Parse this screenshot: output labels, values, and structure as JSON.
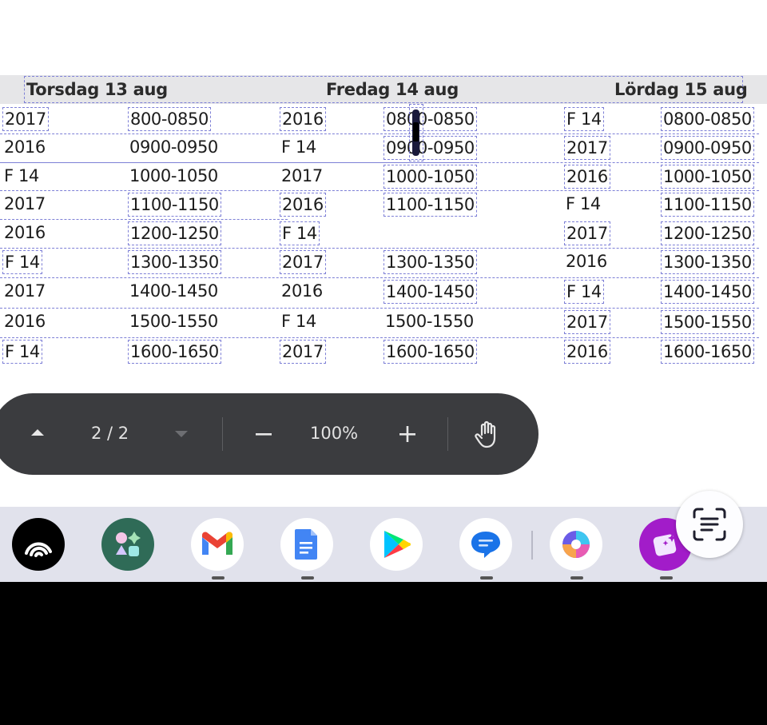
{
  "days": [
    {
      "label": "Torsdag 13 aug"
    },
    {
      "label": "Fredag 14 aug"
    },
    {
      "label": "Lördag 15 aug"
    }
  ],
  "rows": [
    [
      "2017",
      "800-0850",
      "2016",
      "0800-0850",
      "F 14",
      "0800-0850"
    ],
    [
      "2016",
      "0900-0950",
      "F 14",
      "0900-0950",
      "2017",
      "0900-0950"
    ],
    [
      "F 14",
      "1000-1050",
      "2017",
      "1000-1050",
      "2016",
      "1000-1050"
    ],
    [
      "2017",
      "1100-1150",
      "2016",
      "1100-1150",
      "F 14",
      "1100-1150"
    ],
    [
      "2016",
      "1200-1250",
      "F 14",
      "",
      "2017",
      "1200-1250"
    ],
    [
      "F 14",
      "1300-1350",
      "2017",
      "1300-1350",
      "2016",
      "1300-1350"
    ],
    [
      "2017",
      "1400-1450",
      "2016",
      "1400-1450",
      "F 14",
      "1400-1450"
    ],
    [
      "2016",
      "1500-1550",
      "F 14",
      "1500-1550",
      "2017",
      "1500-1550"
    ],
    [
      "F 14",
      "1600-1650",
      "2017",
      "1600-1650",
      "2016",
      "1600-1650"
    ]
  ],
  "viewer": {
    "page_indicator": "2 / 2",
    "zoom": "100%",
    "icons": [
      "chevron-up-icon",
      "chevron-down-icon",
      "zoom-out-icon",
      "zoom-in-icon",
      "hand-tool-icon"
    ]
  },
  "taskbar": {
    "apps": [
      "podcast-app-icon",
      "app-drawer-icon",
      "gmail-icon",
      "docs-icon",
      "play-store-icon",
      "messages-icon",
      "copilot-icon",
      "ai-photo-icon"
    ],
    "lens_icon": "screen-search-icon"
  },
  "colors": {
    "toolbar_bg": "#3b3c3f",
    "taskbar_bg": "#e1e2ec",
    "header_band": "#e6e6e8",
    "selection_box": "#7d7fd6"
  }
}
